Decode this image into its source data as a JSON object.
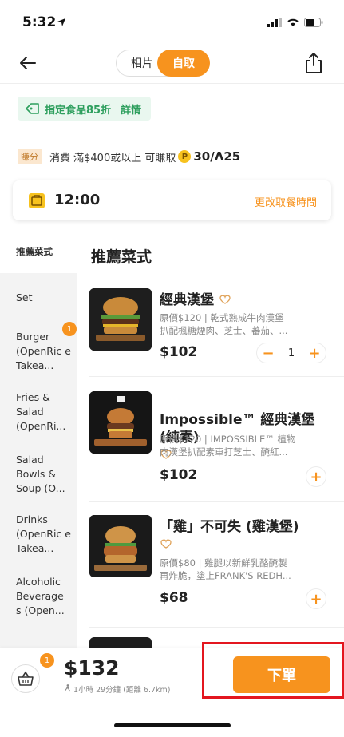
{
  "status_bar": {
    "time": "5:32"
  },
  "nav": {
    "tab_photos": "相片",
    "tab_pickup": "自取"
  },
  "promo": {
    "label": "指定食品85折",
    "link": "詳情"
  },
  "points": {
    "badge": "賺分",
    "text_before": "消費 滿$400或以上 可賺取",
    "coin": "P",
    "reward": "30/Λ25"
  },
  "pickup_time": {
    "value": "12:00",
    "change_label": "更改取餐時間"
  },
  "sidebar": {
    "items": [
      "推薦菜式",
      "Set",
      "Burger (OpenRic e Takea...",
      "Fries & Salad (OpenRi...",
      "Salad Bowls & Soup (O...",
      "Drinks (OpenRic e Takea...",
      "Alcoholic Beverage s (Open..."
    ],
    "burger_badge": "1"
  },
  "section_title": "推薦菜式",
  "menu": {
    "items": [
      {
        "name": "經典漢堡",
        "desc": "原價$120 | 乾式熟成牛肉漢堡\n扒配楓糖煙肉、芝士、蕃茄、...",
        "price": "$102",
        "qty": "1"
      },
      {
        "name": "Impossible™ 經典漢堡\n(純素)",
        "desc": "原價$120 | IMPOSSIBLE™ 植物\n肉漢堡扒配素車打芝士、醃紅...",
        "price": "$102"
      },
      {
        "name": "「雞」不可失 (雞漢堡)",
        "desc": "原價$80 | 雞腿以新鮮乳酪醃製\n再炸脆，塗上FRANK'S REDH...",
        "price": "$68"
      }
    ],
    "minus": "−",
    "plus": "+"
  },
  "cart": {
    "badge": "1",
    "total": "$132",
    "eta": "1小時 29分鐘 (距離 6.7km)",
    "order_label": "下單"
  },
  "colors": {
    "accent": "#f7931e",
    "promo_green": "#2e9f5e",
    "highlight": "#e3161f"
  }
}
